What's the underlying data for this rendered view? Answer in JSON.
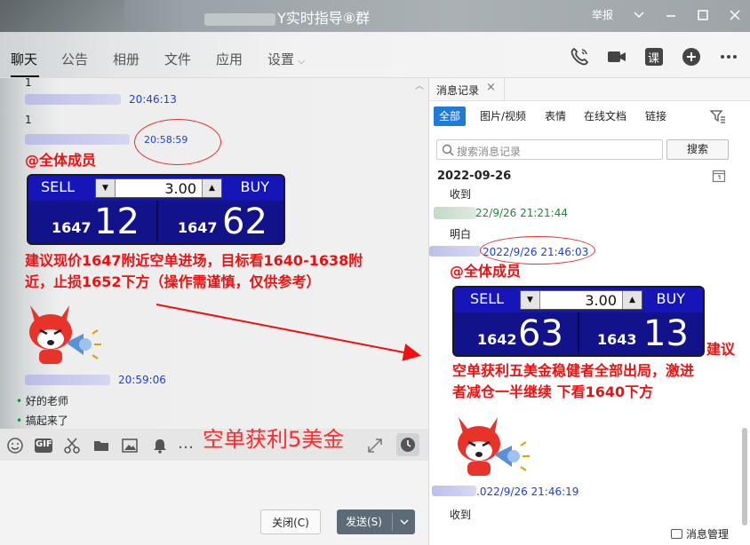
{
  "window": {
    "title_suffix": "Y实时指导⑧群",
    "report": "举报",
    "controls": [
      "chevron-down-icon",
      "minimize-icon",
      "maximize-icon",
      "close-icon"
    ]
  },
  "tabs": [
    {
      "label": "聊天",
      "active": true
    },
    {
      "label": "公告"
    },
    {
      "label": "相册"
    },
    {
      "label": "文件"
    },
    {
      "label": "应用"
    },
    {
      "label": "设置"
    }
  ],
  "tab_icons": [
    "phone-icon",
    "video-icon",
    "lesson-icon",
    "add-icon",
    "more-icon"
  ],
  "lesson_icon_label": "课",
  "chat": {
    "msg0_text": "1",
    "msg1_time": "20:46:13",
    "msg1_text": "1",
    "msg2_time": "20:58:59",
    "mention": "@全体成员",
    "trade": {
      "sell_label": "SELL",
      "buy_label": "BUY",
      "lot": "3.00",
      "sell_prefix": "1647",
      "sell_big": "12",
      "buy_prefix": "1647",
      "buy_big": "62"
    },
    "advice_line1": "建议现价1647附近空单进场，目标看1640-1638附",
    "advice_line2": "近，止损1652下方（操作需谨慎，仅供参考）",
    "msg3_time": "20:59:06",
    "reply1": "好的老师",
    "reply2": "搞起来了",
    "profit_annotation": "空单获利5美金"
  },
  "input": {
    "toolbar_icons": [
      "emoji-icon",
      "gif-icon",
      "scissors-icon",
      "folder-icon",
      "image-icon",
      "bell-icon",
      "more-dots-icon",
      "expand-icon",
      "history-icon"
    ],
    "gif_label": "GIF",
    "more_label": "…",
    "close_label": "关闭(C)",
    "send_label": "发送(S)"
  },
  "history": {
    "tab_label": "消息记录",
    "filters": [
      "全部",
      "图片/视频",
      "表情",
      "在线文档",
      "链接"
    ],
    "search_placeholder": "搜索消息记录",
    "search_button": "搜索",
    "date": "2022-09-26",
    "line1": "收到",
    "time1": "22/9/26 21:21:44",
    "line2": "明白",
    "time2": "2022/9/26 21:46:03",
    "mention": "@全体成员",
    "trade": {
      "sell_label": "SELL",
      "buy_label": "BUY",
      "lot": "3.00",
      "sell_prefix": "1642",
      "sell_big": "63",
      "buy_prefix": "1643",
      "buy_big": "13"
    },
    "advice_line1": "建议",
    "advice_line2": "空单获利五美金稳健者全部出局，激进",
    "advice_line3": "者减仓一半继续 下看1640下方",
    "time3": ".022/9/26 21:46:19",
    "line3": "收到",
    "footer": "消息管理"
  },
  "colors": {
    "accent": "#1f7ad8",
    "annotation_red": "#ee1111",
    "time_blue": "#1e3fd8",
    "time_green": "#1a8a3a",
    "trade_blue": "#1616b8"
  }
}
